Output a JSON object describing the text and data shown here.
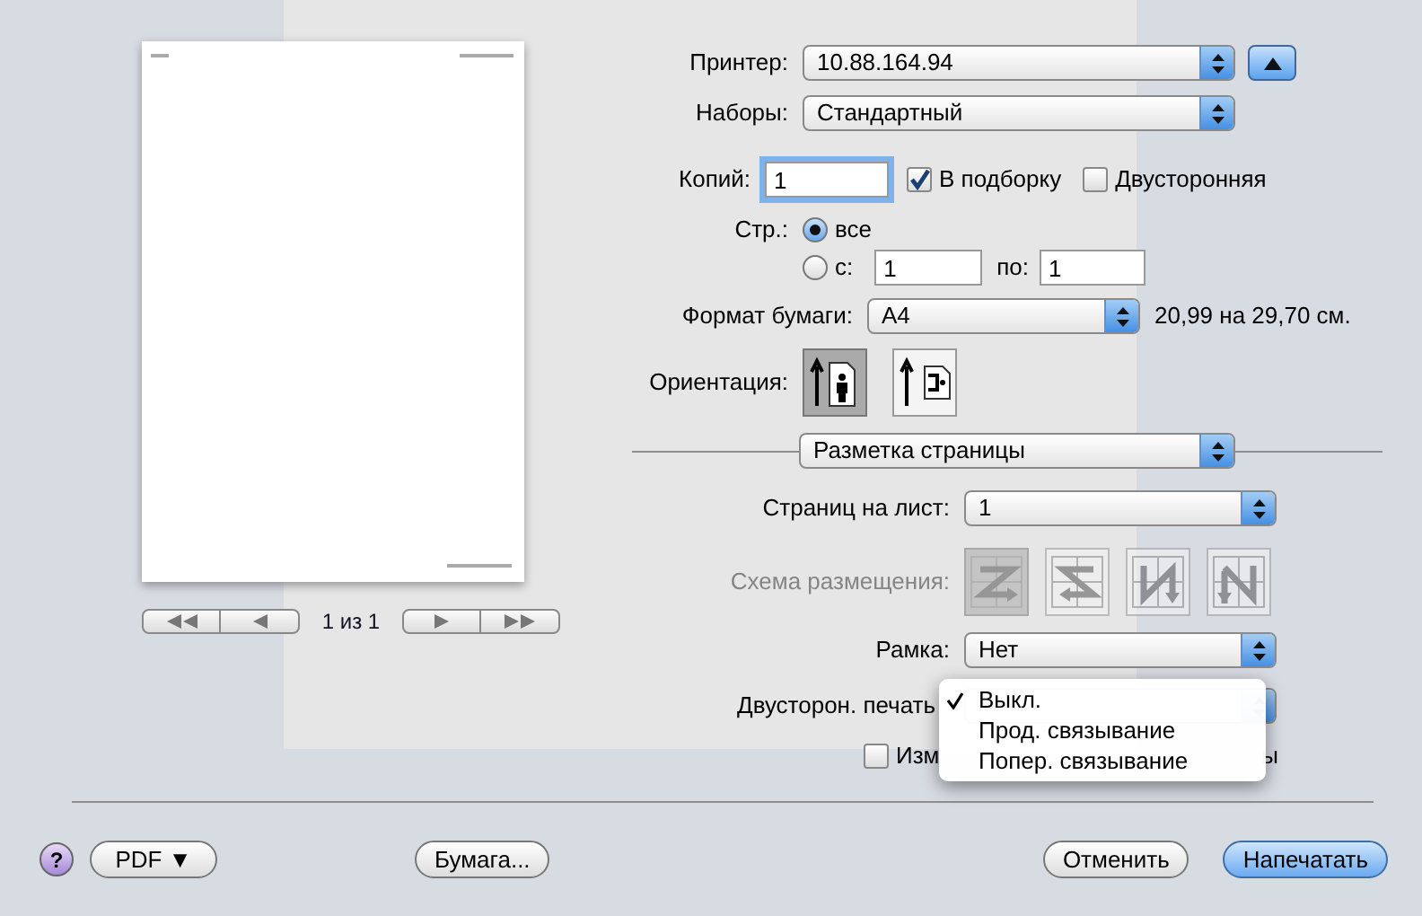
{
  "preview": {
    "page_label": "1 из 1"
  },
  "printer": {
    "label": "Принтер:",
    "value": "10.88.164.94",
    "expanded": true
  },
  "presets": {
    "label": "Наборы:",
    "value": "Стандартный"
  },
  "copies": {
    "label": "Копий:",
    "value": "1",
    "focused": true
  },
  "collate": {
    "label": "В подборку",
    "checked": true
  },
  "two_sided": {
    "label": "Двусторонняя",
    "checked": false
  },
  "pages": {
    "label": "Стр.:",
    "options": [
      {
        "label": "все",
        "selected": true
      },
      {
        "label": "с:",
        "selected": false
      }
    ],
    "from": "1",
    "to_label": "по:",
    "to": "1"
  },
  "paper_size": {
    "label": "Формат бумаги:",
    "value": "A4",
    "dimensions": "20,99 на 29,70 см."
  },
  "orientation": {
    "label": "Ориентация:",
    "options": [
      {
        "kind": "portrait",
        "selected": true
      },
      {
        "kind": "landscape",
        "selected": false
      }
    ]
  },
  "section": {
    "value": "Разметка страницы"
  },
  "pages_per_sheet": {
    "label": "Страниц на лист:",
    "value": "1"
  },
  "layout_direction": {
    "label": "Схема размещения:",
    "disabled": true,
    "options": [
      {
        "kind": "z",
        "selected": true
      },
      {
        "kind": "s",
        "selected": false
      },
      {
        "kind": "n-reverse",
        "selected": false
      },
      {
        "kind": "n",
        "selected": false
      }
    ]
  },
  "border": {
    "label": "Рамка:",
    "value": "Нет"
  },
  "duplex": {
    "label": "Двусторон. печать",
    "menu": [
      {
        "label": "Выкл.",
        "selected": true
      },
      {
        "label": "Прод. связывание",
        "selected": false
      },
      {
        "label": "Попер. связывание",
        "selected": false
      }
    ]
  },
  "reverse_option": {
    "label": "Изм",
    "tail": "ы",
    "checked": false
  },
  "buttons": {
    "help": "?",
    "pdf": "PDF ▼",
    "paper": "Бумага...",
    "cancel": "Отменить",
    "print": "Напечатать"
  }
}
